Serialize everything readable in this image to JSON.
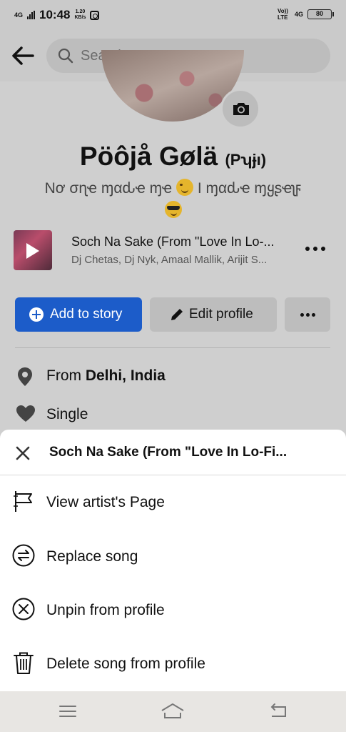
{
  "status_bar": {
    "network": "4G",
    "time": "10:48",
    "speed_value": "1.20",
    "speed_unit": "KB/s",
    "volte": "Vo)) LTE",
    "network_right": "4G",
    "battery": "80"
  },
  "header": {
    "search_placeholder": "Search"
  },
  "profile": {
    "name": "Pöôjå Gølä",
    "nickname": "(Pʮɉı)",
    "bio": "Nơ σɳҽ ɱαԃҽ ɱҽ",
    "bio_end": "I ɱαԃҽ ɱყʂҽʅϝ",
    "bio_emoji_1": "smirking-face",
    "bio_emoji_2": "sunglasses-face"
  },
  "song": {
    "title": "Soch Na Sake (From \"Love In Lo-...",
    "artists": "Dj Chetas, Dj Nyk, Amaal Mallik, Arijit S..."
  },
  "actions": {
    "add_story": "Add to story",
    "edit_profile": "Edit profile"
  },
  "details": {
    "from_prefix": "From ",
    "from_place": "Delhi, India",
    "relationship": "Single"
  },
  "sheet": {
    "title": "Soch Na Sake (From \"Love In Lo-Fi...",
    "items": [
      {
        "label": "View artist's Page",
        "icon": "flag-icon"
      },
      {
        "label": "Replace song",
        "icon": "swap-icon"
      },
      {
        "label": "Unpin from profile",
        "icon": "unpin-icon"
      },
      {
        "label": "Delete song from profile",
        "icon": "trash-icon"
      }
    ]
  },
  "colors": {
    "accent": "#1c5cc9",
    "overlay_bg": "#cfcfcf",
    "sheet_bg": "#ffffff"
  }
}
